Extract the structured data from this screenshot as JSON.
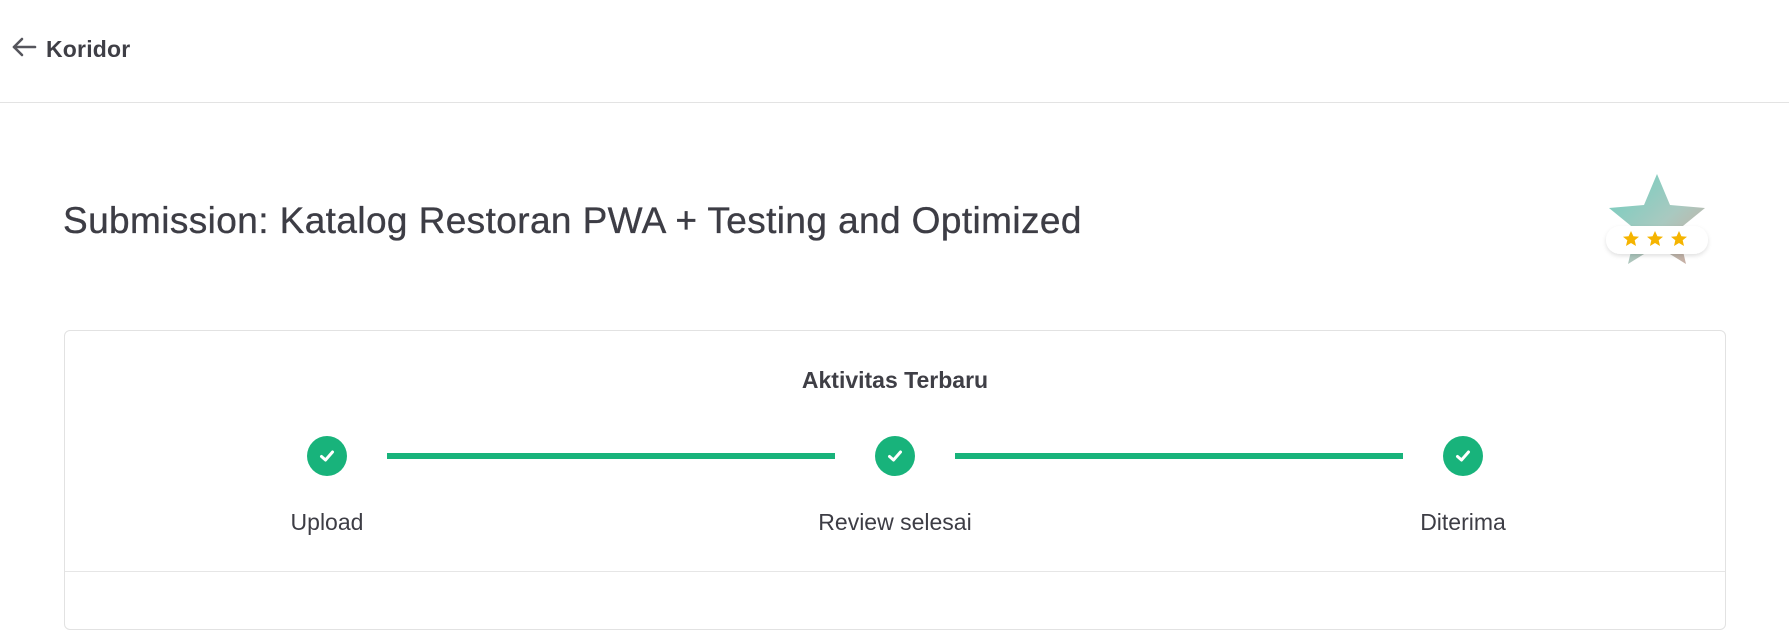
{
  "nav": {
    "back_icon": "arrow-left-icon",
    "back_label": "Koridor"
  },
  "page": {
    "title": "Submission: Katalog Restoran PWA + Testing and Optimized"
  },
  "badge": {
    "icon": "star-badge-icon",
    "stars": 3,
    "star_color": "#f5b400"
  },
  "activity": {
    "title": "Aktivitas Terbaru",
    "accent_color": "#18b37b",
    "steps": [
      {
        "label": "Upload",
        "status": "done",
        "icon": "check-icon"
      },
      {
        "label": "Review selesai",
        "status": "done",
        "icon": "check-icon"
      },
      {
        "label": "Diterima",
        "status": "done",
        "icon": "check-icon"
      }
    ]
  }
}
